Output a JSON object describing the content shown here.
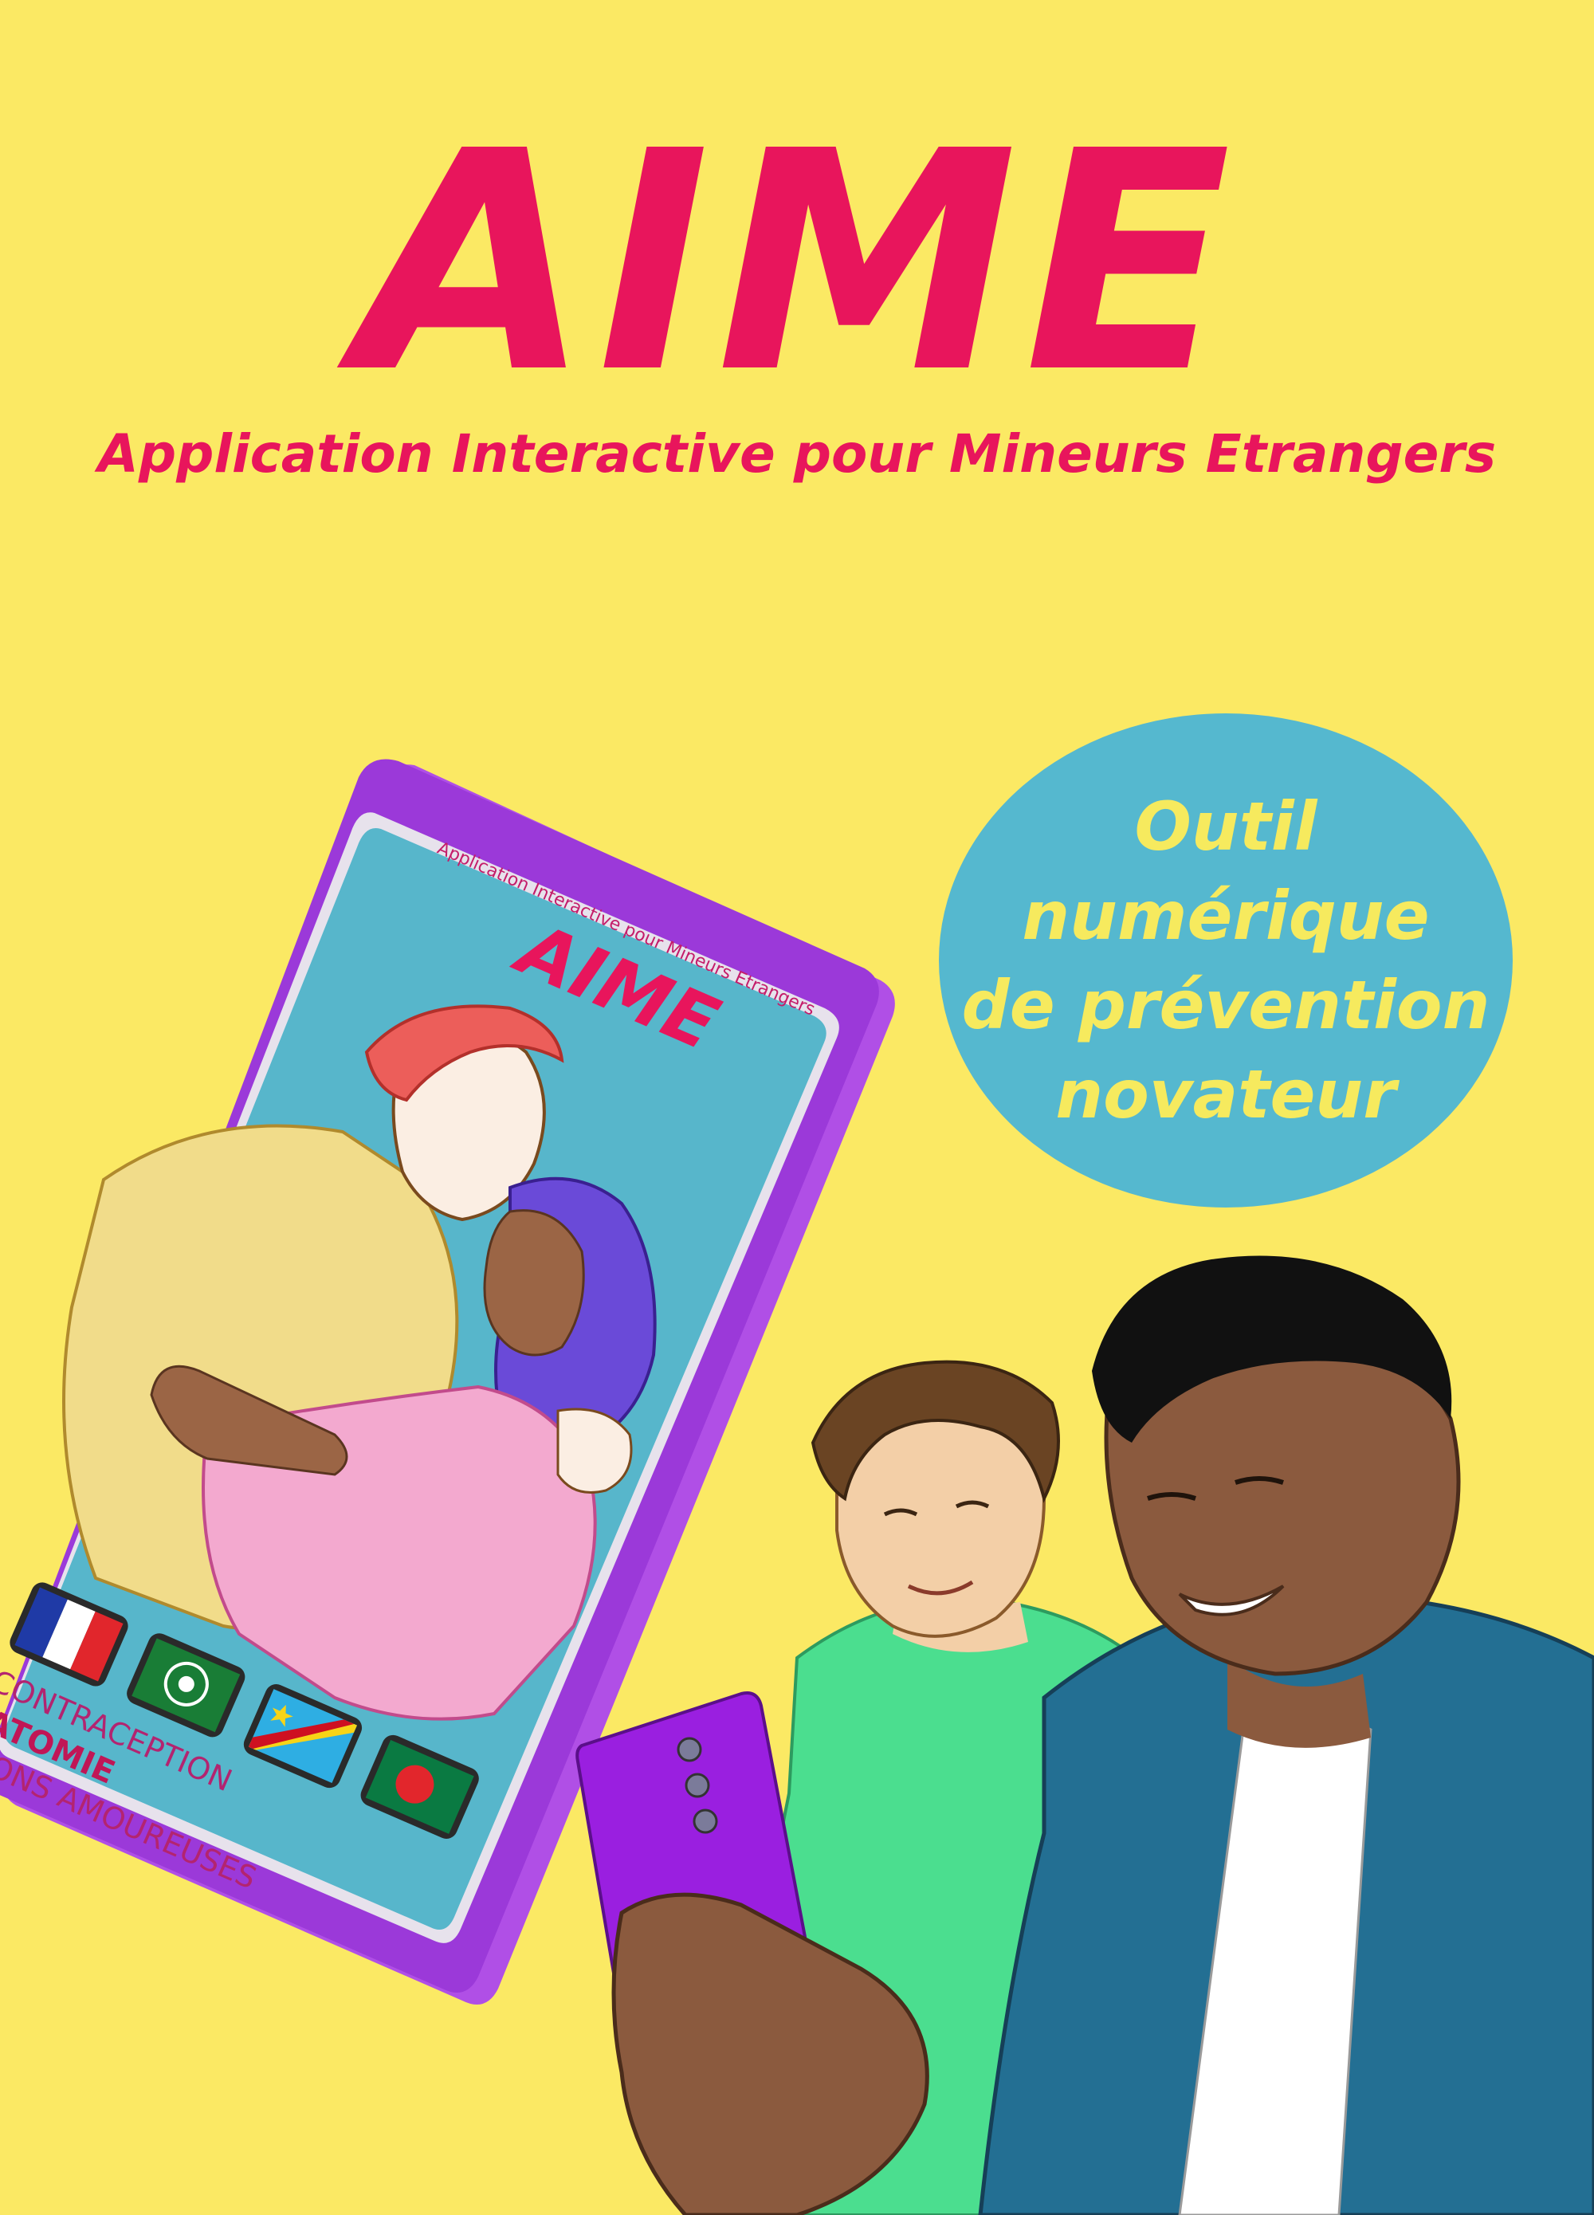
{
  "poster": {
    "title": "AIME",
    "subtitle": "Application Interactive pour Mineurs Etrangers",
    "badge_lines": [
      "Outil",
      "numérique",
      "de prévention",
      "novateur"
    ]
  },
  "phone_screen": {
    "title": "AIME",
    "subtitle": "Application Interactive pour Mineurs Etrangers",
    "menu": [
      "CONTRACEPTION",
      "ANATOMIE",
      "RELATIONS AMOUREUSES"
    ],
    "flags": [
      "france-flag-icon",
      "arab-league-flag-icon",
      "dr-congo-flag-icon",
      "bangladesh-flag-icon"
    ]
  },
  "colors": {
    "background": "#fbe964",
    "title": "#e8155c",
    "badge": "#55b8cf",
    "badge_text": "#f6ea5e",
    "phone_frame": "#9b39d9",
    "phone_screen": "#57b6cb",
    "handheld_phone": "#9a1fe0"
  }
}
